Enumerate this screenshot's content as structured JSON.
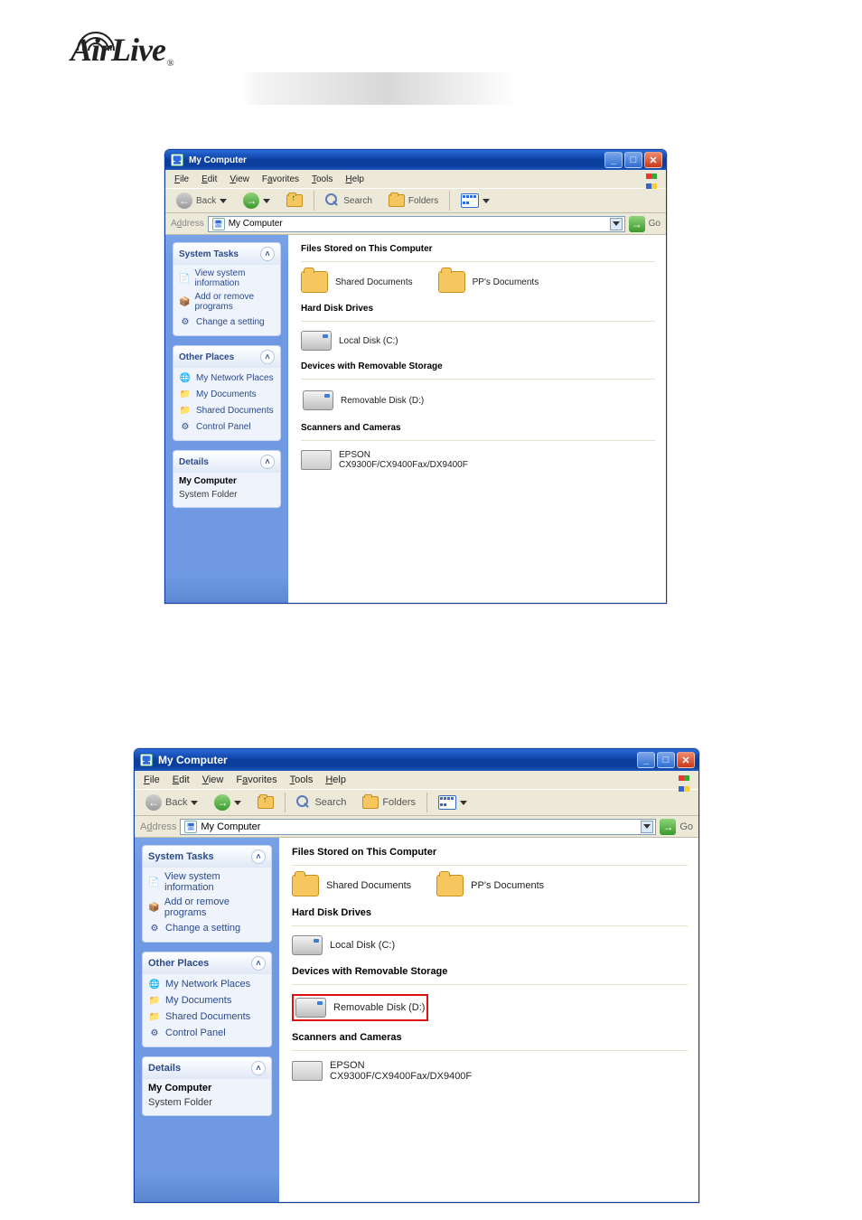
{
  "brand": {
    "name": "AirLive",
    "reg": "®"
  },
  "win1": {
    "title": "My Computer",
    "menus": {
      "file": "File",
      "edit": "Edit",
      "view": "View",
      "favorites": "Favorites",
      "tools": "Tools",
      "help": "Help"
    },
    "toolbar": {
      "back": "Back",
      "search": "Search",
      "folders": "Folders"
    },
    "address": {
      "label": "Address",
      "value": "My Computer",
      "go": "Go"
    },
    "taskpane": {
      "system": {
        "title": "System Tasks",
        "view_info": "View system information",
        "add_remove": "Add or remove programs",
        "change_setting": "Change a setting"
      },
      "other": {
        "title": "Other Places",
        "net_places": "My Network Places",
        "my_docs": "My Documents",
        "shared_docs": "Shared Documents",
        "control_panel": "Control Panel"
      },
      "details": {
        "title": "Details",
        "name": "My Computer",
        "type": "System Folder"
      }
    },
    "sections": {
      "files": "Files Stored on This Computer",
      "shared_docs": "Shared Documents",
      "pp_docs": "PP's Documents",
      "hard_drives": "Hard Disk Drives",
      "local_disk": "Local Disk (C:)",
      "removable_h": "Devices with Removable Storage",
      "removable": "Removable Disk (D:)",
      "scanners_h": "Scanners and Cameras",
      "scanner_name": "EPSON",
      "scanner_model": "CX9300F/CX9400Fax/DX9400F"
    }
  },
  "win2": {
    "title": "My Computer",
    "menus": {
      "file": "File",
      "edit": "Edit",
      "view": "View",
      "favorites": "Favorites",
      "tools": "Tools",
      "help": "Help"
    },
    "toolbar": {
      "back": "Back",
      "search": "Search",
      "folders": "Folders"
    },
    "address": {
      "label": "Address",
      "value": "My Computer",
      "go": "Go"
    },
    "taskpane": {
      "system": {
        "title": "System Tasks",
        "view_info": "View system information",
        "add_remove": "Add or remove programs",
        "change_setting": "Change a setting"
      },
      "other": {
        "title": "Other Places",
        "net_places": "My Network Places",
        "my_docs": "My Documents",
        "shared_docs": "Shared Documents",
        "control_panel": "Control Panel"
      },
      "details": {
        "title": "Details",
        "name": "My Computer",
        "type": "System Folder"
      }
    },
    "sections": {
      "files": "Files Stored on This Computer",
      "shared_docs": "Shared Documents",
      "pp_docs": "PP's Documents",
      "hard_drives": "Hard Disk Drives",
      "local_disk": "Local Disk (C:)",
      "removable_h": "Devices with Removable Storage",
      "removable": "Removable Disk (D:)",
      "scanners_h": "Scanners and Cameras",
      "scanner_name": "EPSON",
      "scanner_model": "CX9300F/CX9400Fax/DX9400F"
    }
  }
}
